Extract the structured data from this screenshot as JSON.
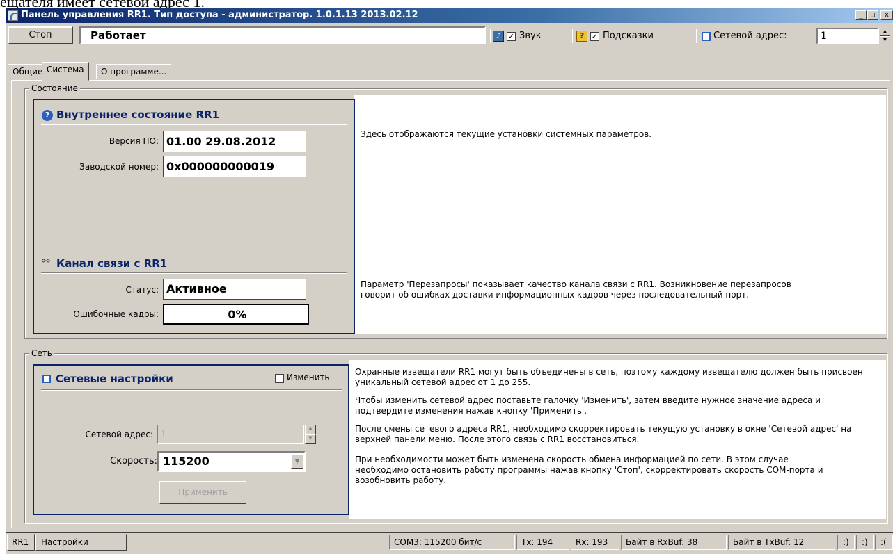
{
  "page_top_text": "ещателя имеет сетевой адрес 1.",
  "window": {
    "title": "Панель управления RR1. Тип доступа - администратор. 1.0.1.13 2013.02.12",
    "minimize": "_",
    "maximize": "□",
    "close": "x"
  },
  "toolbar": {
    "stop_label": "Стоп",
    "status_value": "Работает",
    "sound_label": "Звук",
    "sound_checked": "✓",
    "hints_label": "Подсказки",
    "hints_checked": "✓",
    "netaddr_label": "Сетевой адрес:",
    "netaddr_value": "1"
  },
  "tabs": [
    {
      "label": "Общие"
    },
    {
      "label": "Система"
    },
    {
      "label": "О программе..."
    }
  ],
  "state_group": {
    "legend": "Состояние",
    "internal": {
      "title": "Внутреннее состояние RR1",
      "version_label": "Версия ПО:",
      "version_value": "01.00 29.08.2012",
      "serial_label": "Заводской номер:",
      "serial_value": "0x000000000019"
    },
    "channel": {
      "title": "Канал связи с RR1",
      "status_label": "Статус:",
      "status_value": "Активное",
      "errors_label": "Ошибочные кадры:",
      "errors_value": "0%"
    },
    "desc_top": "Здесь отображаются текущие установки системных параметров.",
    "desc_bottom": "Параметр 'Перезапросы' показывает качество канала связи с RR1. Возникновение перезапросов говорит об ошибках доставки информационных кадров через последовательный порт."
  },
  "network_group": {
    "legend": "Сеть",
    "title": "Сетевые настройки",
    "change_label": "Изменить",
    "addr_label": "Сетевой адрес:",
    "addr_value": "1",
    "speed_label": "Скорость:",
    "speed_value": "115200",
    "apply_label": "Применить",
    "desc1": "Охранные извещатели RR1 могут быть объединены в сеть, поэтому каждому извещателю должен быть присвоен уникальный сетевой адрес от 1 до 255.",
    "desc2": "Чтобы изменить сетевой адрес поставьте галочку 'Изменить', затем введите нужное значение адреса и подтвердите изменения нажав кнопку 'Применить'.",
    "desc3": "После смены сетевого адреса RR1, необходимо скорректировать текущую установку в окне 'Сетевой адрес' на верхней панели меню. После этого связь с RR1 восстановиться.",
    "desc4": "При необходимости может быть изменена скорость обмена информацией по сети. В этом случае необходимо остановить работу программы нажав кнопку 'Стоп', скорректировать скорость COM-порта и возобновить работу."
  },
  "bottom_tabs": [
    {
      "label": "RR1"
    },
    {
      "label": "Настройки"
    }
  ],
  "statusbar": {
    "port": "COM3: 115200 бит/с",
    "tx": "Tx: 194",
    "rx": "Rx: 193",
    "rxbuf": "Байт в RxBuf: 38",
    "txbuf": "Байт в TxBuf: 12",
    "smile1": ":)",
    "smile2": ":)",
    "smile3": ":("
  },
  "colors": {
    "title_bar": "#0a246a",
    "card_border": "#0a246a",
    "face": "#d4d0c8"
  }
}
